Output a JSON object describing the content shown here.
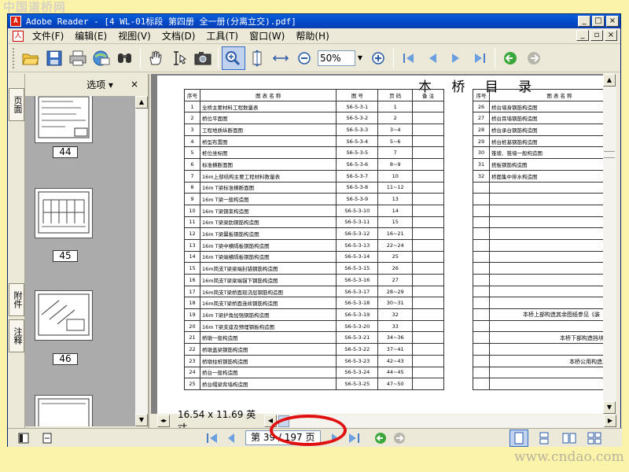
{
  "watermarks": {
    "top": "中国道桥网",
    "bottom": "www.cndao.com"
  },
  "window": {
    "title": "Adobe Reader - [4 WL-01标段 第四册 全一册(分离立交).pdf]",
    "controls": {
      "minimize": "_",
      "maximize": "□",
      "close": "×"
    }
  },
  "menu": {
    "items": [
      "文件(F)",
      "编辑(E)",
      "视图(V)",
      "文档(D)",
      "工具(T)",
      "窗口(W)",
      "帮助(H)"
    ],
    "doc_controls": {
      "minimize": "_",
      "restore": "▫",
      "close": "×"
    }
  },
  "toolbar": {
    "zoom_value": "50%",
    "icons": [
      "open-icon",
      "save-icon",
      "print-icon",
      "email-icon",
      "search-icon",
      "hand-icon",
      "select-text-icon",
      "snapshot-icon",
      "zoom-in-tool-icon",
      "fit-page-icon",
      "fit-width-icon",
      "zoom-out-icon",
      "zoom-in-icon",
      "first-page-icon",
      "prev-page-icon",
      "next-page-icon",
      "last-page-icon",
      "go-back-icon",
      "go-forward-icon"
    ]
  },
  "nav_tabs": {
    "pages": "页面",
    "attachments": "附件",
    "comments": "注释"
  },
  "thumbnails": {
    "options_label": "选项 ▾",
    "close": "×",
    "pages": [
      "44",
      "45",
      "46"
    ]
  },
  "document": {
    "title": "本 桥 目 录",
    "headers": {
      "no": "序号",
      "name": "图 表 名 称",
      "code": "图 号",
      "page": "页 码",
      "remark": "备 注"
    },
    "left_rows": [
      [
        "1",
        "全桥主要材料工程数量表",
        "S6-5-3-1",
        "1"
      ],
      [
        "2",
        "桥位平面图",
        "S6-5-3-2",
        "2"
      ],
      [
        "3",
        "工程地质纵断面图",
        "S6-5-3-3",
        "3~4"
      ],
      [
        "4",
        "桥型布置图",
        "S6-5-3-4",
        "5~6"
      ],
      [
        "5",
        "桩位坐标图",
        "S6-5-3-5",
        "7"
      ],
      [
        "6",
        "标准横断面图",
        "S6-5-3-6",
        "8~9"
      ],
      [
        "7",
        "16m上部结构主要工程材料数量表",
        "S6-5-3-7",
        "10"
      ],
      [
        "8",
        "16m T梁标准横断面图",
        "S6-5-3-8",
        "11~12"
      ],
      [
        "9",
        "16m T梁一般构造图",
        "S6-5-3-9",
        "13"
      ],
      [
        "10",
        "16m T梁钢束构造图",
        "S6-5-3-10",
        "14"
      ],
      [
        "11",
        "16m T梁梁肋钢筋构造图",
        "S6-5-3-11",
        "15"
      ],
      [
        "12",
        "16m T梁翼板钢筋构造图",
        "S6-5-3-12",
        "16~21"
      ],
      [
        "13",
        "16m T梁中横隔板钢筋构造图",
        "S6-5-3-13",
        "22~24"
      ],
      [
        "14",
        "16m T梁端横隔板钢筋构造图",
        "S6-5-3-14",
        "25"
      ],
      [
        "15",
        "16m简支T梁梁端封锚钢筋构造图",
        "S6-5-3-15",
        "26"
      ],
      [
        "16",
        "16m简支T梁梁端锚下钢筋构造图",
        "S6-5-3-16",
        "27"
      ],
      [
        "17",
        "16m简支T梁桥面现浇层钢筋构造图",
        "S6-5-3-17",
        "28~29"
      ],
      [
        "18",
        "16m简支T梁桥面连续钢筋构造图",
        "S6-5-3-18",
        "30~31"
      ],
      [
        "19",
        "16m T梁护角加强钢筋构造图",
        "S6-5-3-19",
        "32"
      ],
      [
        "20",
        "16m T梁支座及预埋钢板构造图",
        "S6-5-3-20",
        "33"
      ],
      [
        "21",
        "桥墩一般构造图",
        "S6-5-3-21",
        "34~36"
      ],
      [
        "22",
        "桥墩盖梁钢筋构造图",
        "S6-5-3-22",
        "37~41"
      ],
      [
        "23",
        "桥墩柱桩钢筋构造图",
        "S6-5-3-23",
        "42~43"
      ],
      [
        "24",
        "桥台一般构造图",
        "S6-5-3-24",
        "44~45"
      ],
      [
        "25",
        "桥台帽梁背墙构造图",
        "S6-5-3-25",
        "47~50"
      ]
    ],
    "right_rows": [
      [
        "26",
        "桥台墙身钢筋构造图"
      ],
      [
        "27",
        "桥台耳墙钢筋构造图"
      ],
      [
        "28",
        "桥台承台钢筋构造图"
      ],
      [
        "29",
        "桥台桩基钢筋构造图"
      ],
      [
        "30",
        "锥坡、锥墙一般构造图"
      ],
      [
        "31",
        "搭板钢筋构造图"
      ],
      [
        "32",
        "桥面集中排水构造图"
      ]
    ],
    "notes": [
      "本桥上部构造其余图纸参见《装",
      "本桥下部构造挡块",
      "本桥公用构造其"
    ]
  },
  "page_size": "16.54 x 11.69 英寸",
  "status": {
    "page_indicator": "第 39 / 197 页"
  }
}
